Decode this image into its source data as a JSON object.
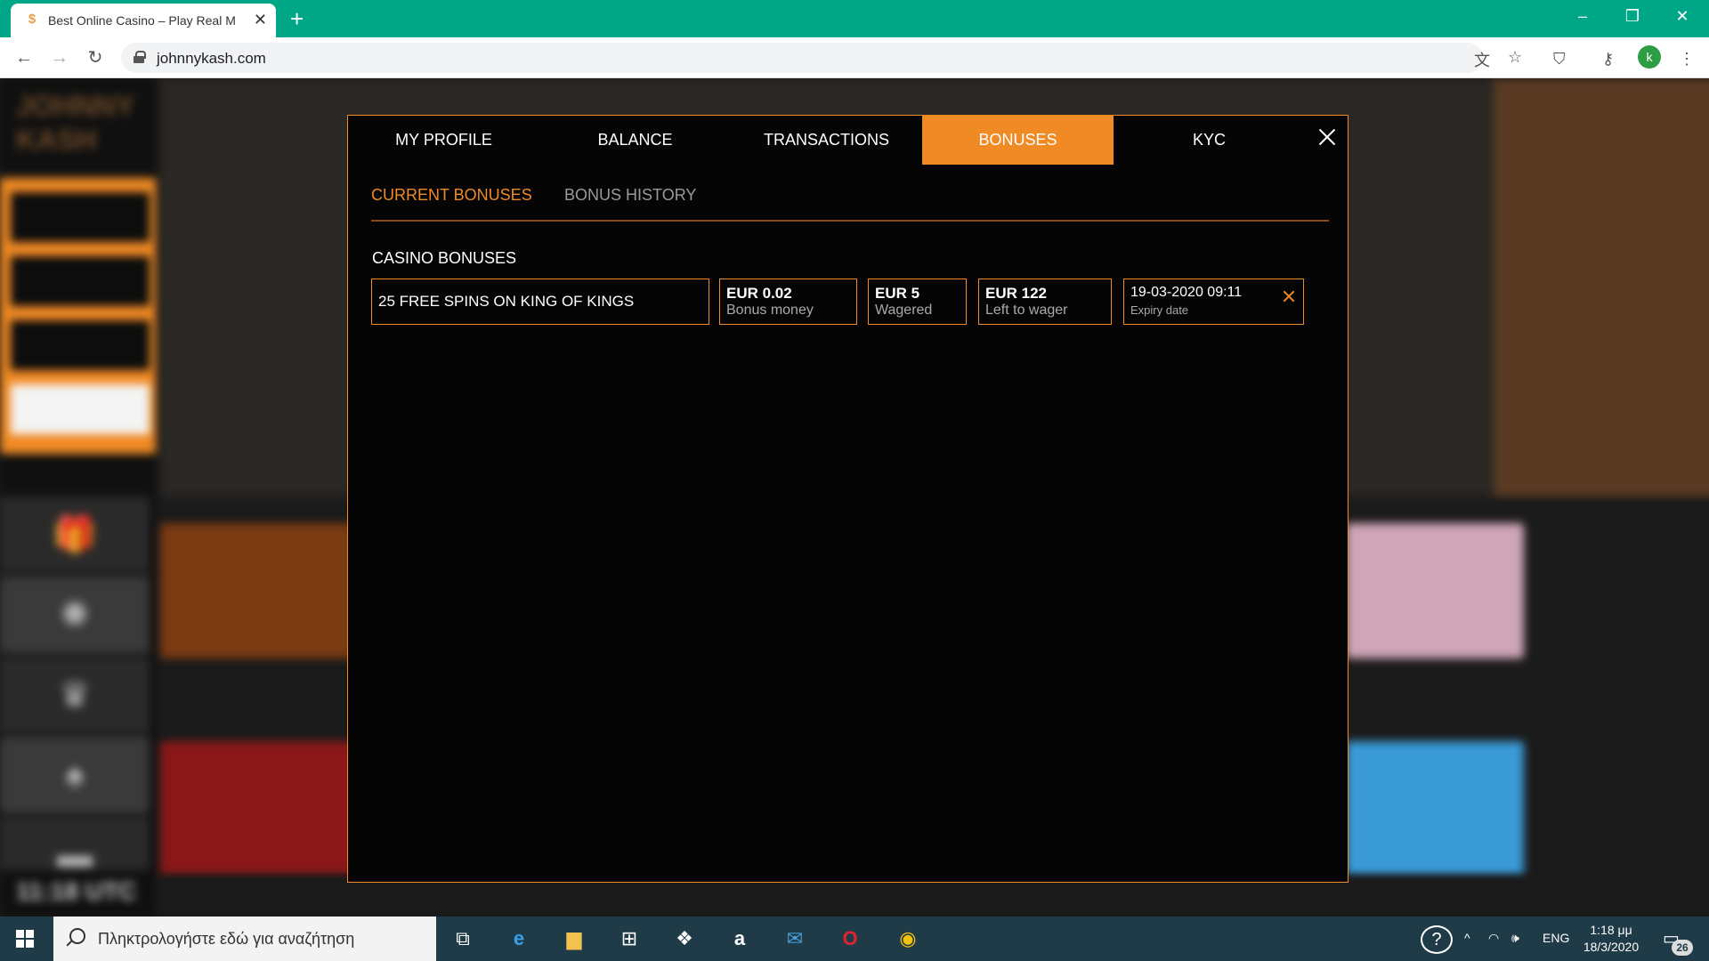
{
  "browser": {
    "tab_title": "Best Online Casino – Play Real M",
    "tab_favicon": "dollar-icon",
    "url": "johnnykash.com",
    "profile_initial": "k",
    "theme_color": "#00a786"
  },
  "modal": {
    "accent_color": "#f08a24",
    "tabs": [
      {
        "label": "MY PROFILE",
        "active": false
      },
      {
        "label": "BALANCE",
        "active": false
      },
      {
        "label": "TRANSACTIONS",
        "active": false
      },
      {
        "label": "BONUSES",
        "active": true
      },
      {
        "label": "KYC",
        "active": false
      }
    ],
    "subtabs": [
      {
        "label": "CURRENT BONUSES",
        "active": true
      },
      {
        "label": "BONUS HISTORY",
        "active": false
      }
    ],
    "section_title": "CASINO BONUSES",
    "bonus": {
      "name": "25 FREE SPINS ON KING OF KINGS",
      "bonus_money_value": "EUR 0.02",
      "bonus_money_label": "Bonus money",
      "wagered_value": "EUR 5",
      "wagered_label": "Wagered",
      "left_value": "EUR 122",
      "left_label": "Left to wager",
      "expiry_value": "19-03-2020 09:11",
      "expiry_label": "Expiry date"
    }
  },
  "background_page": {
    "utc_time": "11:18 UTC"
  },
  "taskbar": {
    "search_placeholder": "Πληκτρολογήστε εδώ για αναζήτηση",
    "language": "ENG",
    "time": "1:18 μμ",
    "date": "18/3/2020",
    "notification_count": "26"
  }
}
